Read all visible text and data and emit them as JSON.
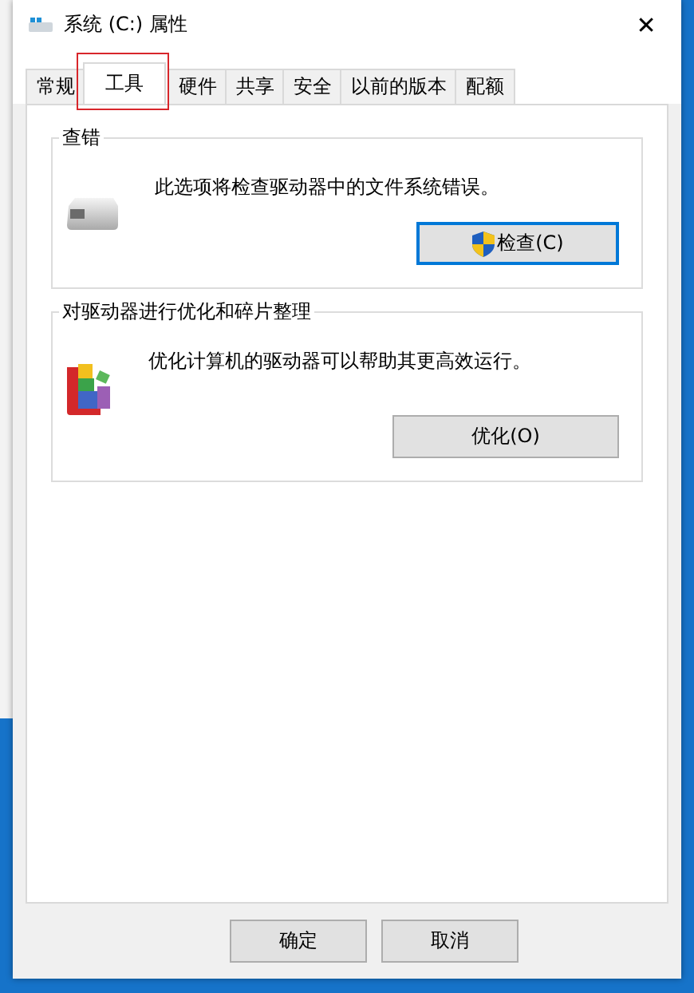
{
  "window": {
    "title": "系统 (C:) 属性",
    "close": "✕"
  },
  "tabs": [
    {
      "label": "常规",
      "selected": false
    },
    {
      "label": "工具",
      "selected": true
    },
    {
      "label": "硬件",
      "selected": false
    },
    {
      "label": "共享",
      "selected": false
    },
    {
      "label": "安全",
      "selected": false
    },
    {
      "label": "以前的版本",
      "selected": false
    },
    {
      "label": "配额",
      "selected": false
    }
  ],
  "highlight_selected_tab": true,
  "groups": [
    {
      "kind": "check",
      "title": "查错",
      "text": "此选项将检查驱动器中的文件系统错误。",
      "button": {
        "label": "检查(C)",
        "default": true,
        "shield": true
      }
    },
    {
      "kind": "optimize",
      "title": "对驱动器进行优化和碎片整理",
      "text": "优化计算机的驱动器可以帮助其更高效运行。",
      "button": {
        "label": "优化(O)",
        "default": false,
        "shield": false
      }
    }
  ],
  "buttons": [
    "确定",
    "取消"
  ]
}
